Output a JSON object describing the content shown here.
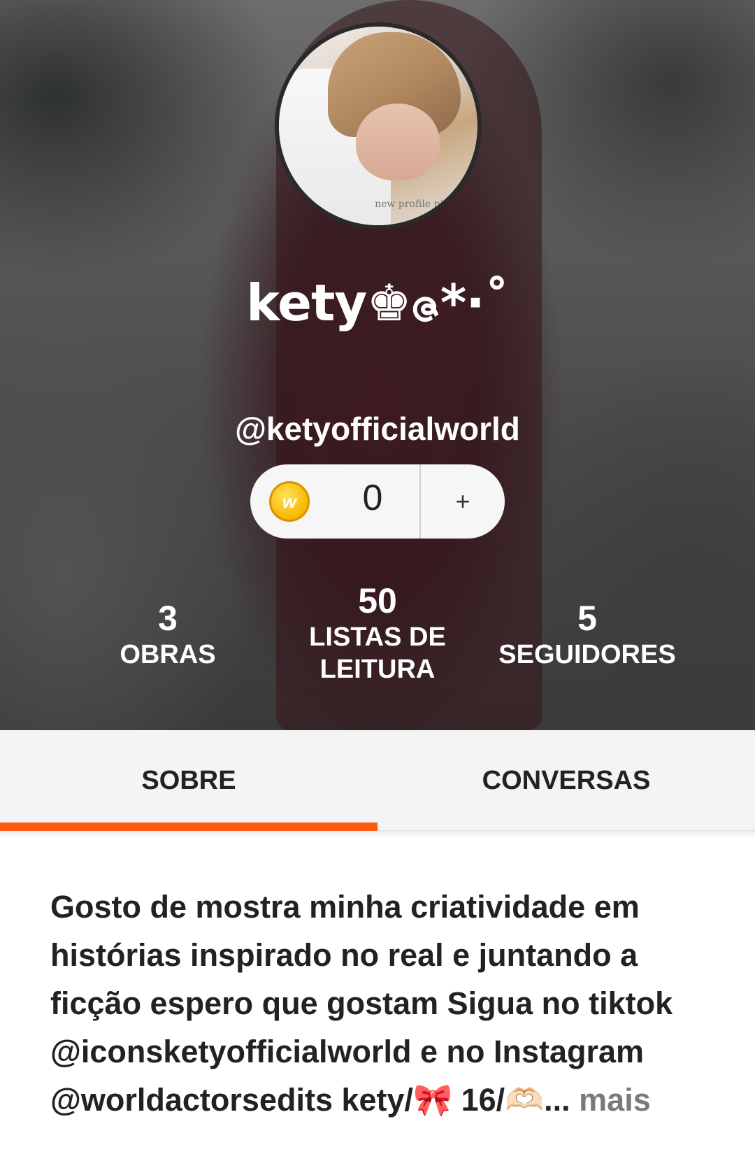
{
  "profile": {
    "display_name": "kety♚ဇ*·˚",
    "username": "@ketyofficialworld",
    "avatar_watermark": "new profile pic"
  },
  "coins": {
    "icon_letter": "w",
    "balance": "0",
    "add_label": "+"
  },
  "stats": [
    {
      "value": "3",
      "label": "OBRAS"
    },
    {
      "value": "50",
      "label": "LISTAS DE LEITURA"
    },
    {
      "value": "5",
      "label": "SEGUIDORES"
    }
  ],
  "tabs": [
    {
      "label": "SOBRE",
      "active": true
    },
    {
      "label": "CONVERSAS",
      "active": false
    }
  ],
  "bio": {
    "text": "Gosto de mostra minha criatividade em histórias inspirado no real e juntando a ficção espero que gostam Sigua no tiktok @iconsketyofficialworld e no Instagram @worldactorsedits kety/🎀 16/🫶🏻...",
    "more_label": " mais"
  },
  "colors": {
    "accent": "#ff5a12",
    "tab_bar_bg": "#f4f4f4",
    "coin": "#f7b800"
  },
  "icons": {
    "coin": "wattpad-coin-icon"
  }
}
